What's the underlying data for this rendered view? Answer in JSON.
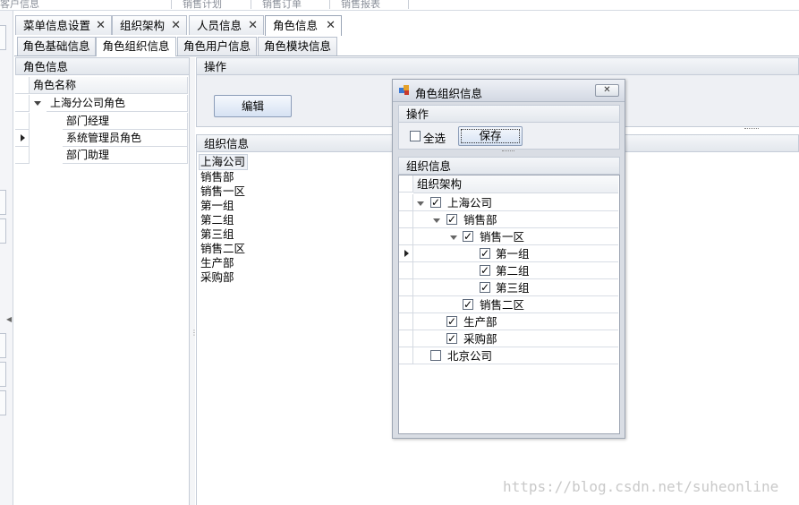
{
  "top_menu": [
    "客户信息",
    "销售计划",
    "销售订单",
    "销售报表"
  ],
  "main_tabs": [
    {
      "label": "菜单信息设置"
    },
    {
      "label": "组织架构"
    },
    {
      "label": "人员信息"
    },
    {
      "label": "角色信息"
    }
  ],
  "tab_close_glyph": "✕",
  "sub_tabs": [
    {
      "label": "角色基础信息"
    },
    {
      "label": "角色组织信息"
    },
    {
      "label": "角色用户信息"
    },
    {
      "label": "角色模块信息"
    }
  ],
  "role_panel": {
    "title": "角色信息",
    "column_header": "角色名称",
    "root": "上海分公司角色",
    "children": [
      "部门经理",
      "系统管理员角色",
      "部门助理"
    ]
  },
  "operation_panel": {
    "title": "操作",
    "edit_label": "编辑"
  },
  "org_panel": {
    "title": "组织信息",
    "items": [
      "上海公司",
      "销售部",
      "销售一区",
      "第一组",
      "第二组",
      "第三组",
      "销售二区",
      "生产部",
      "采购部"
    ]
  },
  "dialog": {
    "title": "角色组织信息",
    "close_glyph": "✕",
    "operation_title": "操作",
    "select_all_label": "全选",
    "save_label": "保存",
    "org_title": "组织信息",
    "tree_header": "组织架构",
    "tree": [
      {
        "label": "上海公司",
        "checked": true
      },
      {
        "label": "销售部",
        "checked": true
      },
      {
        "label": "销售一区",
        "checked": true
      },
      {
        "label": "第一组",
        "checked": true
      },
      {
        "label": "第二组",
        "checked": true
      },
      {
        "label": "第三组",
        "checked": true
      },
      {
        "label": "销售二区",
        "checked": true
      },
      {
        "label": "生产部",
        "checked": true
      },
      {
        "label": "采购部",
        "checked": true
      },
      {
        "label": "北京公司",
        "checked": false
      }
    ]
  },
  "watermark": "https://blog.csdn.net/suheonline"
}
